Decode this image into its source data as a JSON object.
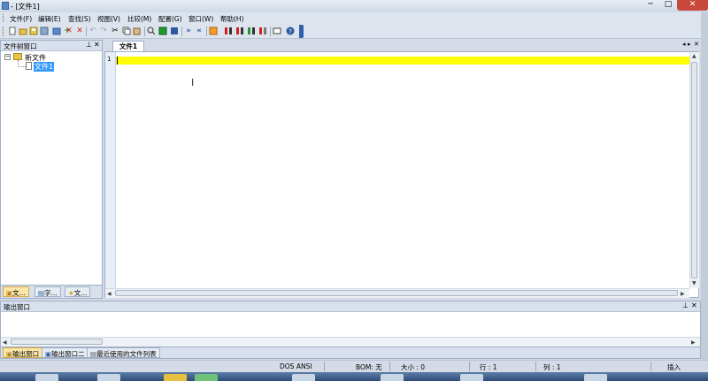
{
  "window": {
    "title": "- [文件1]",
    "min_label": "─",
    "max_label": "□",
    "close_label": "✕"
  },
  "menu": [
    "文件(F)",
    "编辑(E)",
    "查找(S)",
    "视图(V)",
    "比较(M)",
    "配置(G)",
    "窗口(W)",
    "帮助(H)"
  ],
  "toolbar": {
    "icons": [
      "new-file-icon",
      "open-file-icon",
      "save-icon",
      "save-all-icon",
      "print-icon",
      "add-icon",
      "close-icon",
      "close-all-icon",
      "undo-icon",
      "redo-icon",
      "cut-icon",
      "copy-icon",
      "paste-icon",
      "find-icon",
      "replace-icon",
      "goto-icon",
      "prev-diff-icon",
      "next-diff-icon",
      "compare-icon",
      "sync-icon",
      "sync-left-icon",
      "sync-right-icon",
      "merge-icon",
      "hex-icon",
      "help-icon"
    ]
  },
  "tree_panel": {
    "title": "文件树窗口",
    "pin": "⊥",
    "close": "✕",
    "root_label": "新文件",
    "expander": "−",
    "child_label": "文件1",
    "tabs": [
      "文...",
      "字...",
      "文..."
    ]
  },
  "editor": {
    "tab_label": "文件1",
    "line_number": "1",
    "nav_left": "◂",
    "nav_right": "▸",
    "close": "✕",
    "ibeam": "I"
  },
  "output_panel": {
    "title": "输出窗口",
    "pin": "⊥",
    "close": "✕",
    "tabs": [
      "输出窗口",
      "输出窗口二",
      "最近使用的文件列表"
    ]
  },
  "status": {
    "encoding": "DOS  ANSI",
    "bom": "BOM: 无",
    "size": "大小 : 0",
    "row": "行 : 1",
    "col": "列 : 1",
    "mode": "插入"
  },
  "colors": {
    "current_line": "#ffff00",
    "selection": "#3399ff",
    "active_tab": "#fbe6a7",
    "close_button": "#c9483c"
  }
}
